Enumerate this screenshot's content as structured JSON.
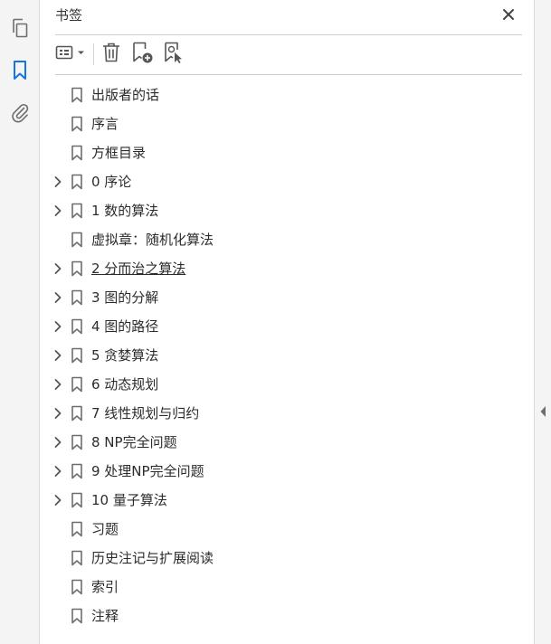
{
  "panel": {
    "title": "书签"
  },
  "rail": {
    "items": [
      {
        "name": "pages-icon",
        "active": false
      },
      {
        "name": "bookmark-icon",
        "active": true
      },
      {
        "name": "attachment-icon",
        "active": false
      }
    ]
  },
  "toolbar": {
    "buttons": [
      "options-menu-icon",
      "delete-icon",
      "new-bookmark-icon",
      "bookmark-from-selection-icon"
    ]
  },
  "colors": {
    "accent": "#1473e6",
    "icon": "#6e6e6e",
    "text": "#2c2c2c"
  },
  "bookmarks": [
    {
      "label": "出版者的话",
      "expandable": false,
      "underline": false
    },
    {
      "label": "序言",
      "expandable": false,
      "underline": false
    },
    {
      "label": "方框目录",
      "expandable": false,
      "underline": false
    },
    {
      "label": "0 序论",
      "expandable": true,
      "underline": false
    },
    {
      "label": "1 数的算法",
      "expandable": true,
      "underline": false
    },
    {
      "label": "虚拟章：随机化算法",
      "expandable": false,
      "underline": false
    },
    {
      "label": "2 分而治之算法",
      "expandable": true,
      "underline": true
    },
    {
      "label": "3 图的分解",
      "expandable": true,
      "underline": false
    },
    {
      "label": "4 图的路径",
      "expandable": true,
      "underline": false
    },
    {
      "label": "5 贪婪算法",
      "expandable": true,
      "underline": false
    },
    {
      "label": "6 动态规划",
      "expandable": true,
      "underline": false
    },
    {
      "label": "7 线性规划与归约",
      "expandable": true,
      "underline": false
    },
    {
      "label": "8 NP完全问题",
      "expandable": true,
      "underline": false
    },
    {
      "label": "9 处理NP完全问题",
      "expandable": true,
      "underline": false
    },
    {
      "label": "10 量子算法",
      "expandable": true,
      "underline": false
    },
    {
      "label": "习题",
      "expandable": false,
      "underline": false
    },
    {
      "label": "历史注记与扩展阅读",
      "expandable": false,
      "underline": false
    },
    {
      "label": "索引",
      "expandable": false,
      "underline": false
    },
    {
      "label": "注释",
      "expandable": false,
      "underline": false
    }
  ]
}
